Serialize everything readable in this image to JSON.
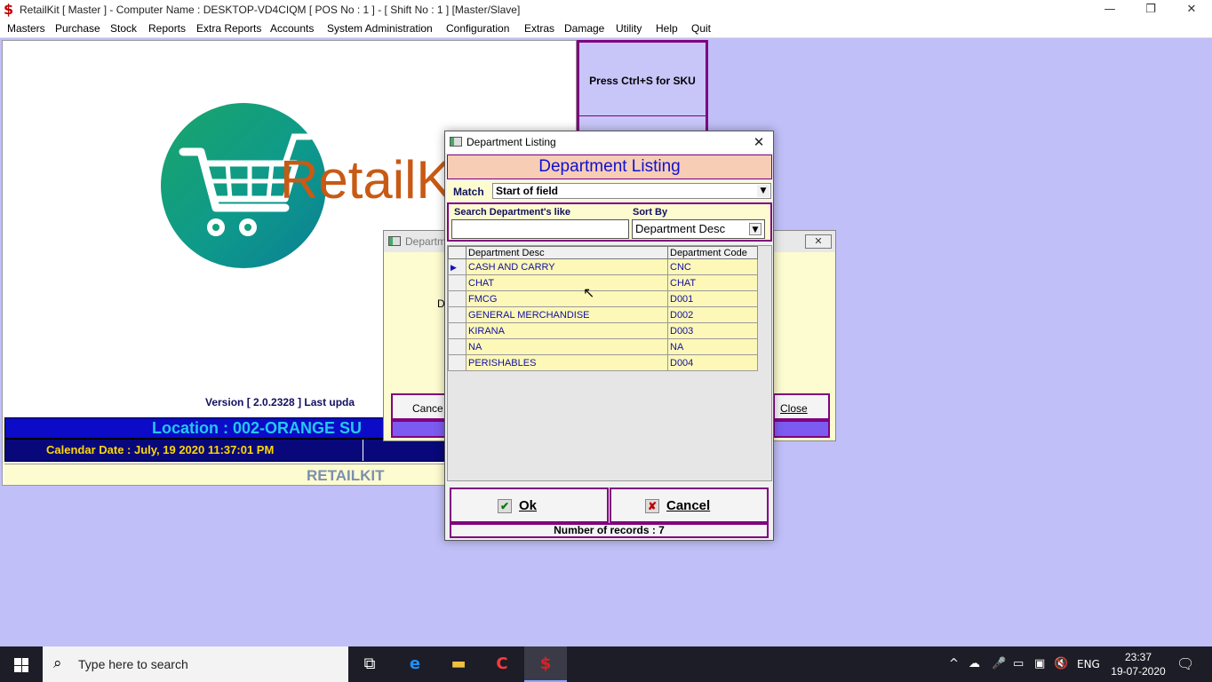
{
  "window": {
    "title": "RetailKit [ Master ] - Computer Name : DESKTOP-VD4CIQM [ POS No : 1 ] - [ Shift No : 1 ]  [Master/Slave]",
    "minimize": "—",
    "restore": "❐",
    "close": "✕"
  },
  "menu": [
    "Masters",
    "Purchase",
    "Stock",
    "Reports",
    "Extra Reports",
    "Accounts",
    "System Administration",
    "Configuration",
    "Extras",
    "Damage",
    "Utility",
    "Help",
    "Quit"
  ],
  "main": {
    "logo_text": "RetailK",
    "version": "Version [ 2.0.2328 ]  Last upda",
    "location": "Location : 002-ORANGE SU",
    "calendar": "Calendar Date : July, 19 2020 11:37:01 PM",
    "brand": "RETAILKIT",
    "sku_button": "Press Ctrl+S for SKU"
  },
  "bg_dialog": {
    "title": "Departm",
    "label": "D",
    "cancel": "Cance",
    "close": "Close"
  },
  "dialog": {
    "title": "Department Listing",
    "header": "Department Listing",
    "match_label": "Match",
    "match_value": "Start of field",
    "search_label": "Search Department's like",
    "search_value": "",
    "sort_label": "Sort By",
    "sort_value": "Department Desc",
    "columns": [
      "Department Desc",
      "Department Code"
    ],
    "rows": [
      [
        "CASH AND CARRY",
        "CNC"
      ],
      [
        "CHAT",
        "CHAT"
      ],
      [
        "FMCG",
        "D001"
      ],
      [
        "GENERAL MERCHANDISE",
        "D002"
      ],
      [
        "KIRANA",
        "D003"
      ],
      [
        "NA",
        "NA"
      ],
      [
        "PERISHABLES",
        "D004"
      ]
    ],
    "ok": "Ok",
    "cancel": "Cancel",
    "records": "Number of records : 7"
  },
  "taskbar": {
    "search_placeholder": "Type here to search",
    "language": "ENG",
    "time": "23:37",
    "date": "19-07-2020"
  },
  "colors": {
    "desktop_bg": "#c0bff8",
    "accent_purple": "#800080",
    "header_peach": "#f7cdb6",
    "grid_yellow": "#fdf8b8",
    "location_blue": "#0b0bc8",
    "calendar_yellow": "#ffd700"
  }
}
